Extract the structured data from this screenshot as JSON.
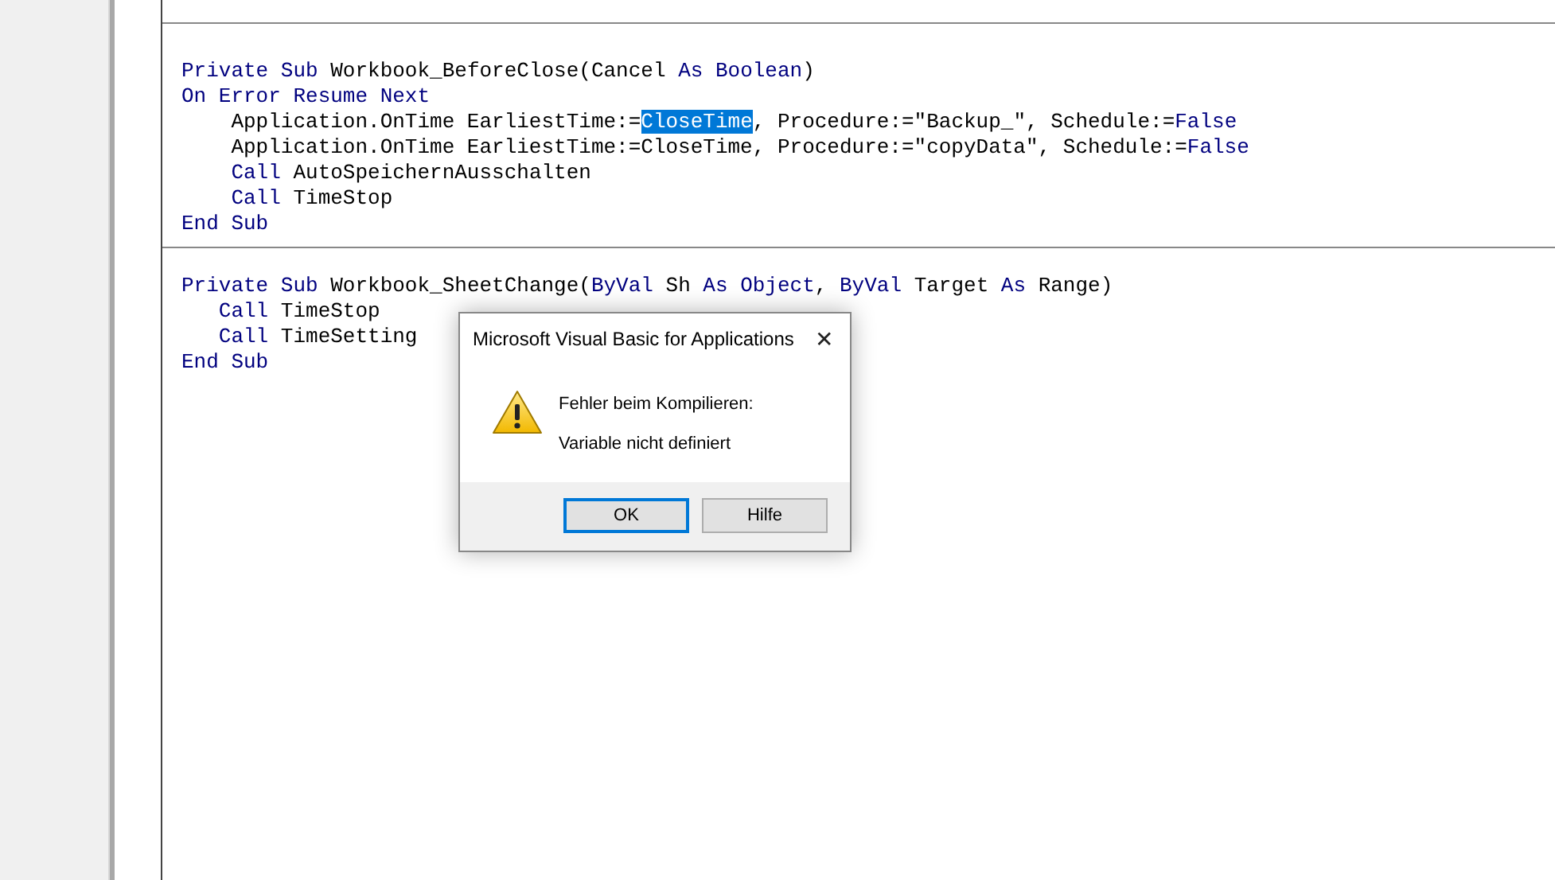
{
  "procedures": [
    {
      "lines": [
        [
          {
            "text": "Private Sub ",
            "kind": "keyword"
          },
          {
            "text": "Workbook_BeforeClose(Cancel ",
            "kind": "plain"
          },
          {
            "text": "As Boolean",
            "kind": "keyword"
          },
          {
            "text": ")",
            "kind": "plain"
          }
        ],
        [
          {
            "text": "On Error Resume Next",
            "kind": "keyword"
          }
        ],
        [
          {
            "text": "    Application.OnTime EarliestTime:=",
            "kind": "plain"
          },
          {
            "text": "CloseTime",
            "kind": "selected"
          },
          {
            "text": ", Procedure:=\"Backup_\", Schedule:=",
            "kind": "plain"
          },
          {
            "text": "False",
            "kind": "keyword"
          }
        ],
        [
          {
            "text": "    Application.OnTime EarliestTime:=CloseTime, Procedure:=\"copyData\", Schedule:=",
            "kind": "plain"
          },
          {
            "text": "False",
            "kind": "keyword"
          }
        ],
        [
          {
            "text": "    Call ",
            "kind": "keyword"
          },
          {
            "text": "AutoSpeichernAusschalten",
            "kind": "plain"
          }
        ],
        [
          {
            "text": "    Call ",
            "kind": "keyword"
          },
          {
            "text": "TimeStop",
            "kind": "plain"
          }
        ],
        [
          {
            "text": "End Sub",
            "kind": "keyword"
          }
        ]
      ]
    },
    {
      "lines": [
        [
          {
            "text": "Private Sub ",
            "kind": "keyword"
          },
          {
            "text": "Workbook_SheetChange(",
            "kind": "plain"
          },
          {
            "text": "ByVal ",
            "kind": "keyword"
          },
          {
            "text": "Sh ",
            "kind": "plain"
          },
          {
            "text": "As Object",
            "kind": "keyword"
          },
          {
            "text": ", ",
            "kind": "plain"
          },
          {
            "text": "ByVal ",
            "kind": "keyword"
          },
          {
            "text": "Target ",
            "kind": "plain"
          },
          {
            "text": "As ",
            "kind": "keyword"
          },
          {
            "text": "Range)",
            "kind": "plain"
          }
        ],
        [
          {
            "text": "   Call ",
            "kind": "keyword"
          },
          {
            "text": "TimeStop",
            "kind": "plain"
          }
        ],
        [
          {
            "text": "   Call ",
            "kind": "keyword"
          },
          {
            "text": "TimeSetting",
            "kind": "plain"
          }
        ],
        [
          {
            "text": "End Sub",
            "kind": "keyword"
          }
        ]
      ]
    }
  ],
  "dialog": {
    "title": "Microsoft Visual Basic for Applications",
    "close": "✕",
    "heading": "Fehler beim Kompilieren:",
    "message": "Variable nicht definiert",
    "buttons": [
      {
        "label": "OK",
        "selected": true
      },
      {
        "label": "Hilfe",
        "selected": false
      }
    ]
  }
}
